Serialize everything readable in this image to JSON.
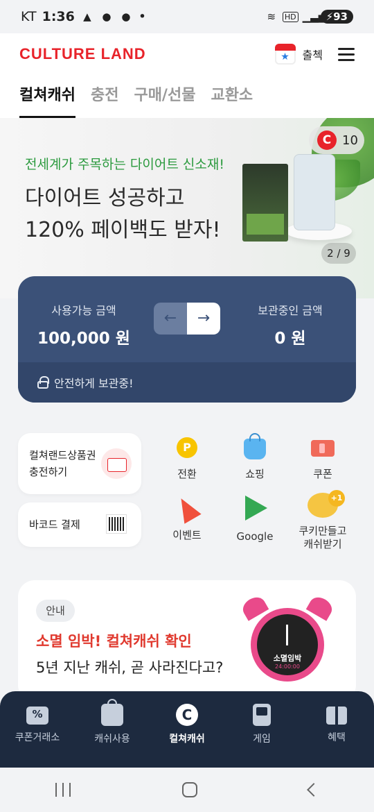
{
  "status_bar": {
    "carrier": "KT",
    "time": "1:36",
    "dot": "•",
    "battery": "93",
    "hd": "HD"
  },
  "header": {
    "logo": "CULTURE LAND",
    "checkin_label": "출첵"
  },
  "tabs": [
    {
      "label": "컬쳐캐쉬",
      "active": true
    },
    {
      "label": "충전",
      "active": false
    },
    {
      "label": "구매/선물",
      "active": false
    },
    {
      "label": "교환소",
      "active": false
    }
  ],
  "banner": {
    "subtitle": "전세계가 주목하는 다이어트 신소재!",
    "headline_1": "다이어트 성공하고",
    "headline_2": "120% 페이백도 받자!",
    "badge_letter": "C",
    "badge_count": "10",
    "pager": "2 / 9"
  },
  "balance": {
    "available_label": "사용가능 금액",
    "available_value": "100,000 원",
    "stored_label": "보관중인 금액",
    "stored_value": "0 원",
    "left_arrow": "←",
    "right_arrow": "→",
    "safe_text": "안전하게 보관중!"
  },
  "quick_cards": {
    "charge_line1": "컬쳐랜드상품권",
    "charge_line2": "충전하기",
    "barcode_label": "바코드 결제"
  },
  "grid": [
    {
      "label": "전환",
      "icon": "point-icon",
      "glyph": "P"
    },
    {
      "label": "쇼핑",
      "icon": "shopping-bag-icon"
    },
    {
      "label": "쿠폰",
      "icon": "coupon-icon"
    },
    {
      "label": "이벤트",
      "icon": "party-popper-icon"
    },
    {
      "label": "Google",
      "icon": "google-play-icon"
    },
    {
      "label": "쿠키만들고\n캐쉬받기",
      "icon": "cookie-icon",
      "badge": "+1"
    }
  ],
  "notice": {
    "tag": "안내",
    "headline": "소멸 임박! 컬쳐캐쉬 확인",
    "subline": "5년 지난 캐쉬, 곧 사라진다고?",
    "clock_text": "소멸임박",
    "clock_time": "24:00:00"
  },
  "bottom_nav": [
    {
      "label": "쿠폰거래소",
      "icon": "coupon-exchange-icon",
      "active": false
    },
    {
      "label": "캐쉬사용",
      "icon": "shopping-bag-icon",
      "active": false
    },
    {
      "label": "컬쳐캐쉬",
      "icon": "culture-cash-icon",
      "glyph": "C",
      "active": true
    },
    {
      "label": "게임",
      "icon": "game-icon",
      "active": false
    },
    {
      "label": "혜택",
      "icon": "gift-icon",
      "active": false
    }
  ],
  "colors": {
    "brand_red": "#e8232a",
    "card_navy": "#3b5178",
    "nav_dark": "#1d2a3f",
    "accent_green": "#2b9a3e",
    "notice_red": "#e0392e"
  }
}
